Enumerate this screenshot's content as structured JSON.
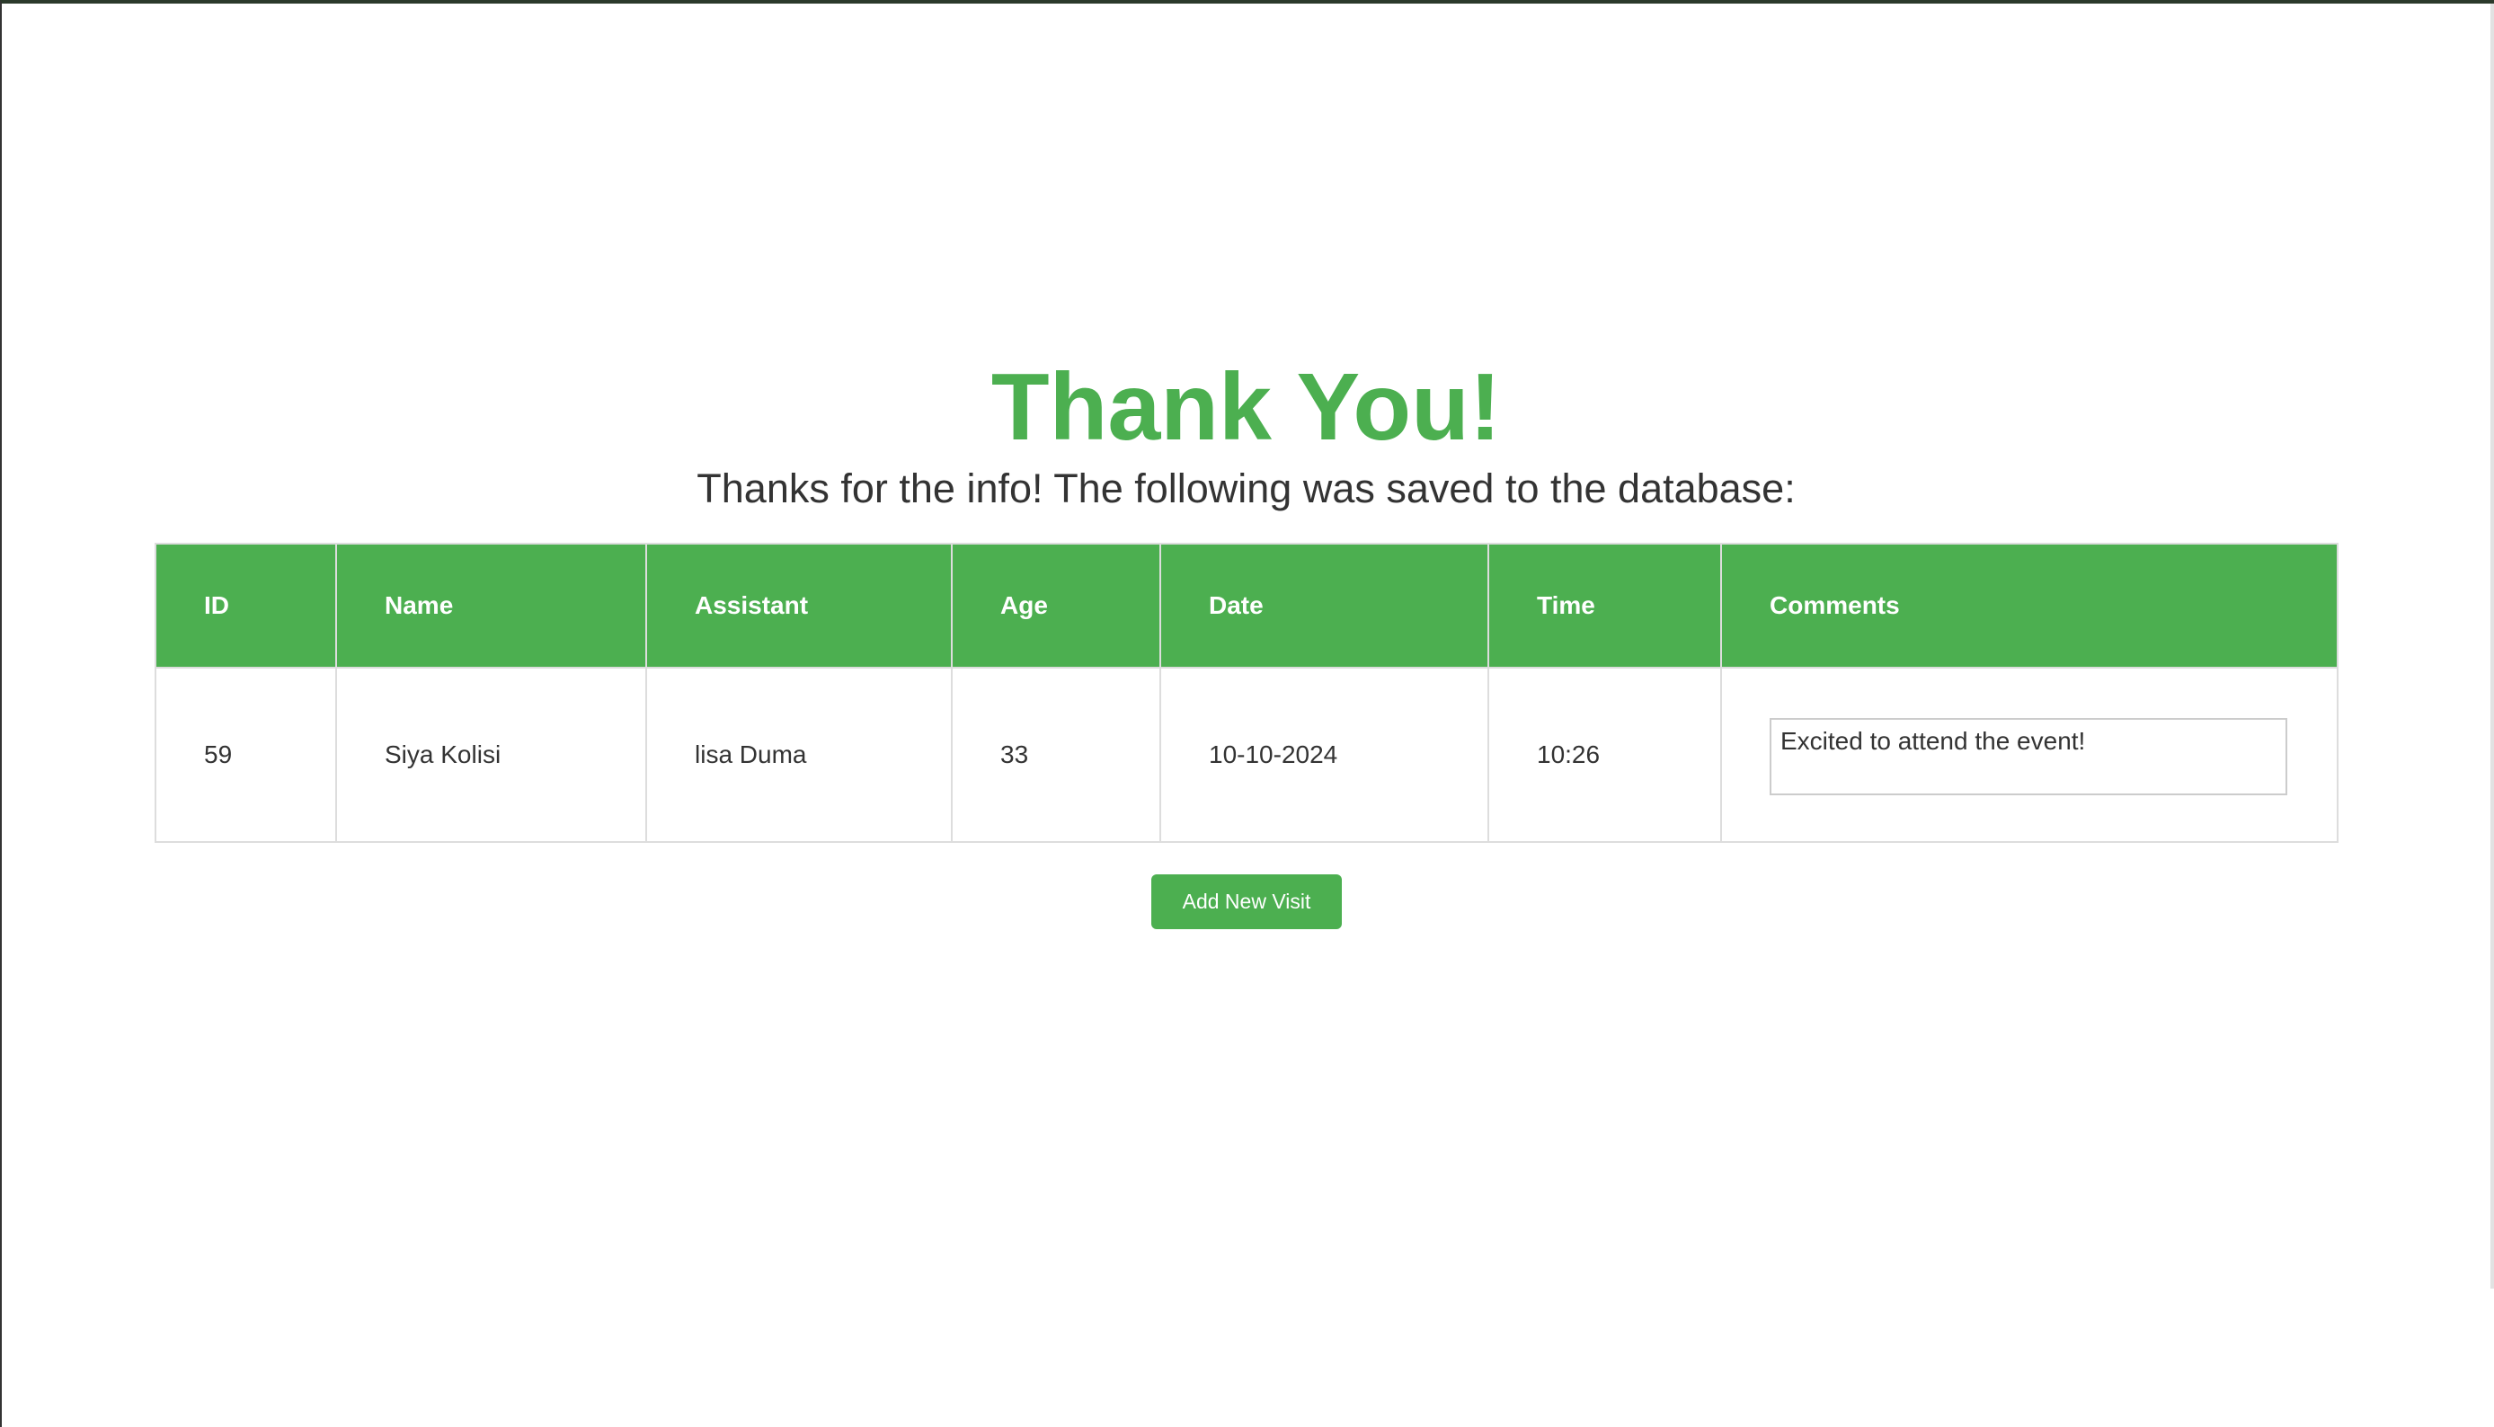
{
  "title": "Thank You!",
  "subtitle": "Thanks for the info! The following was saved to the database:",
  "table": {
    "headers": {
      "id": "ID",
      "name": "Name",
      "assistant": "Assistant",
      "age": "Age",
      "date": "Date",
      "time": "Time",
      "comments": "Comments"
    },
    "rows": [
      {
        "id": "59",
        "name": "Siya Kolisi",
        "assistant": "lisa Duma",
        "age": "33",
        "date": "10-10-2024",
        "time": "10:26",
        "comments": "Excited to attend the event!"
      }
    ]
  },
  "actions": {
    "add_new_visit_label": "Add New Visit"
  },
  "colors": {
    "accent": "#4caf50",
    "text": "#333333",
    "border": "#dddddd"
  }
}
